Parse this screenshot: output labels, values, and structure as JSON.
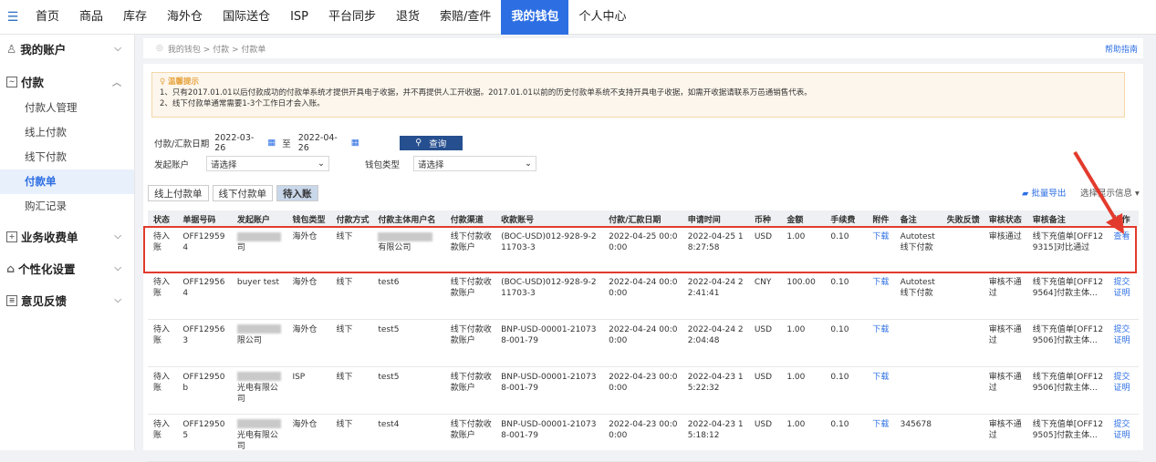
{
  "nav": {
    "items": [
      "首页",
      "商品",
      "库存",
      "海外仓",
      "国际送仓",
      "ISP",
      "平台同步",
      "退货",
      "索赔/查件",
      "我的钱包",
      "个人中心"
    ],
    "active_index": 9
  },
  "sidebar": {
    "account": "我的账户",
    "pay": "付款",
    "items": [
      "付款人管理",
      "线上付款",
      "线下付款",
      "付款单",
      "购汇记录"
    ],
    "active_item": 3,
    "business": "业务收费单",
    "personal": "个性化设置",
    "feedback": "意见反馈"
  },
  "breadcrumb": "我的钱包 > 付款 > 付款单",
  "help": "帮助指南",
  "notice": {
    "title": "温馨提示",
    "lines": [
      "1、只有2017.01.01以后付款成功的付款单系统才提供开具电子收据，并不再提供人工开收据。2017.01.01以前的历史付款单系统不支持开具电子收据，如需开收据请联系万邑通销售代表。",
      "2、线下付款单通常需要1-3个工作日才会入账。"
    ]
  },
  "filters": {
    "date_label": "付款/汇款日期",
    "date_from": "2022-03-26",
    "to_label": "至",
    "date_to": "2022-04-26",
    "query_label": "查询",
    "account_label": "发起账户",
    "account_value": "请选择",
    "wallet_label": "钱包类型",
    "wallet_value": "请选择"
  },
  "tabs": [
    "线上付款单",
    "线下付款单",
    "待入账"
  ],
  "active_tab": 2,
  "tools": {
    "export": "批量导出",
    "display": "选择显示信息"
  },
  "columns": [
    "状态",
    "单据号码",
    "发起账户",
    "钱包类型",
    "付款方式",
    "付款主体用户名",
    "付款渠道",
    "收款账号",
    "付款/汇款日期",
    "申请时间",
    "币种",
    "金额",
    "手续费",
    "附件",
    "备注",
    "失败反馈",
    "审核状态",
    "审核备注",
    "操作"
  ],
  "rows": [
    [
      "待入账",
      "OFF129594",
      "司",
      "海外仓",
      "线下",
      "有限公司",
      "线下付款收款账户",
      "(BOC-USD)012-928-9-211703-3",
      "2022-04-25 00:00:00",
      "2022-04-25 18:27:58",
      "USD",
      "1.00",
      "0.10",
      "下载",
      "Autotest 线下付款",
      "",
      "审核通过",
      "线下充值单[OFF129315]对比通过",
      "查看"
    ],
    [
      "待入账",
      "OFF129564",
      "buyer test",
      "海外仓",
      "线下",
      "test6",
      "线下付款收款账户",
      "(BOC-USD)012-928-9-211703-3",
      "2022-04-24 00:00:00",
      "2022-04-24 22:41:41",
      "CNY",
      "100.00",
      "0.10",
      "下载",
      "Autotest 线下付款",
      "",
      "审核不通过",
      "线下充值单[OFF129564]付款主体...",
      "提交证明"
    ],
    [
      "待入账",
      "OFF129563",
      "限公司",
      "海外仓",
      "线下",
      "test5",
      "线下付款收款账户",
      "BNP-USD-00001-210738-001-79",
      "2022-04-24 00:00:00",
      "2022-04-24 22:04:48",
      "USD",
      "1.00",
      "0.10",
      "下载",
      "",
      "",
      "审核不通过",
      "线下充值单[OFF129506]付款主体...",
      "提交证明"
    ],
    [
      "待入账",
      "OFF12950b",
      "光电有限公司",
      "ISP",
      "线下",
      "test5",
      "线下付款收款账户",
      "BNP-USD-00001-210738-001-79",
      "2022-04-23 00:00:00",
      "2022-04-23 15:22:32",
      "USD",
      "1.00",
      "0.10",
      "下载",
      "",
      "",
      "审核不通过",
      "线下充值单[OFF129506]付款主体...",
      "提交证明"
    ],
    [
      "待入账",
      "OFF129505",
      "光电有限公司",
      "海外仓",
      "线下",
      "test4",
      "线下付款收款账户",
      "BNP-USD-00001-210738-001-79",
      "2022-04-23 00:00:00",
      "2022-04-23 15:18:12",
      "USD",
      "1.00",
      "0.10",
      "下载",
      "345678",
      "",
      "审核不通过",
      "线下充值单[OFF129505]付款主体...",
      "提交证明"
    ]
  ]
}
